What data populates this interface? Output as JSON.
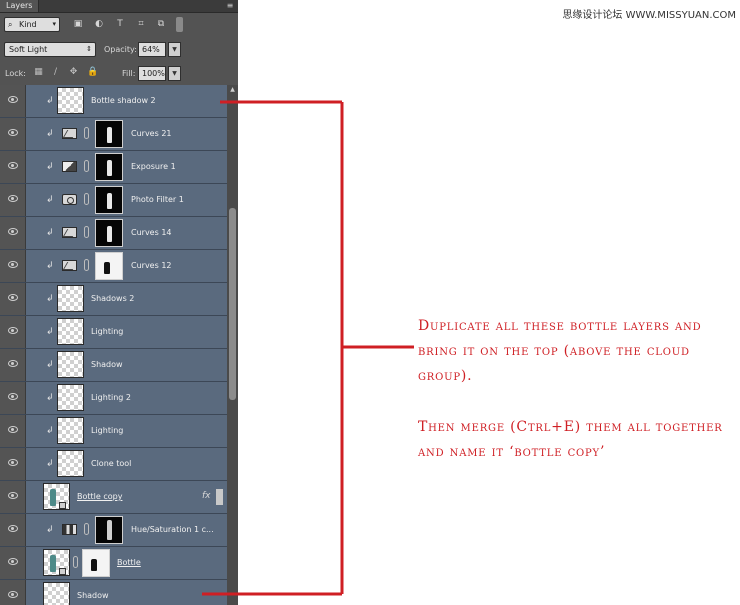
{
  "panel": {
    "tab_label": "Layers",
    "menu_icon": "panel-menu-icon",
    "filter": {
      "kind_label": "Kind",
      "icons": [
        "pixel-filter-icon",
        "adjustment-filter-icon",
        "type-filter-icon",
        "shape-filter-icon",
        "smart-object-filter-icon"
      ]
    },
    "blend_mode": "Soft Light",
    "opacity_label": "Opacity:",
    "opacity_value": "64%",
    "lock_label": "Lock:",
    "fill_label": "Fill:",
    "fill_value": "100%",
    "lock_icons": [
      "lock-transparent-icon",
      "lock-brush-icon",
      "lock-move-icon",
      "lock-all-icon"
    ]
  },
  "layers": [
    {
      "name": "Bottle shadow 2",
      "kind": "pixel",
      "clipped": true
    },
    {
      "name": "Curves 21",
      "kind": "adjustment",
      "icon": "curves",
      "clipped": true,
      "mask": "black"
    },
    {
      "name": "Exposure 1",
      "kind": "adjustment",
      "icon": "exposure",
      "clipped": true,
      "mask": "black"
    },
    {
      "name": "Photo Filter 1",
      "kind": "adjustment",
      "icon": "photo",
      "clipped": true,
      "mask": "black"
    },
    {
      "name": "Curves 14",
      "kind": "adjustment",
      "icon": "curves",
      "clipped": true,
      "mask": "black"
    },
    {
      "name": "Curves 12",
      "kind": "adjustment",
      "icon": "curves",
      "clipped": true,
      "mask": "white"
    },
    {
      "name": "Shadows 2",
      "kind": "pixel",
      "clipped": true
    },
    {
      "name": "Lighting",
      "kind": "pixel",
      "clipped": true
    },
    {
      "name": "Shadow",
      "kind": "pixel",
      "clipped": true
    },
    {
      "name": "Lighting 2",
      "kind": "pixel",
      "clipped": true
    },
    {
      "name": "Lighting",
      "kind": "pixel",
      "clipped": true
    },
    {
      "name": "Clone tool",
      "kind": "pixel",
      "clipped": true
    },
    {
      "name": "Bottle copy",
      "kind": "smart",
      "underline": true,
      "fx": "fx"
    },
    {
      "name": "Hue/Saturation 1 c...",
      "kind": "adjustment",
      "icon": "huesat",
      "clipped": true,
      "mask": "bottle"
    },
    {
      "name": "Bottle",
      "kind": "smart-masked",
      "underline": true
    },
    {
      "name": "Shadow",
      "kind": "base"
    }
  ],
  "annotation": {
    "paragraph1": "Duplicate all these bottle layers and bring it on the top (above the cloud group).",
    "paragraph2": "Then merge (Ctrl+E) them all together and name it ‘bottle copy’"
  },
  "watermark": "思缘设计论坛 WWW.MISSYUAN.COM",
  "colors": {
    "annotation": "#cf1f24",
    "layer_selected": "#5a6a7e",
    "panel": "#535353"
  }
}
